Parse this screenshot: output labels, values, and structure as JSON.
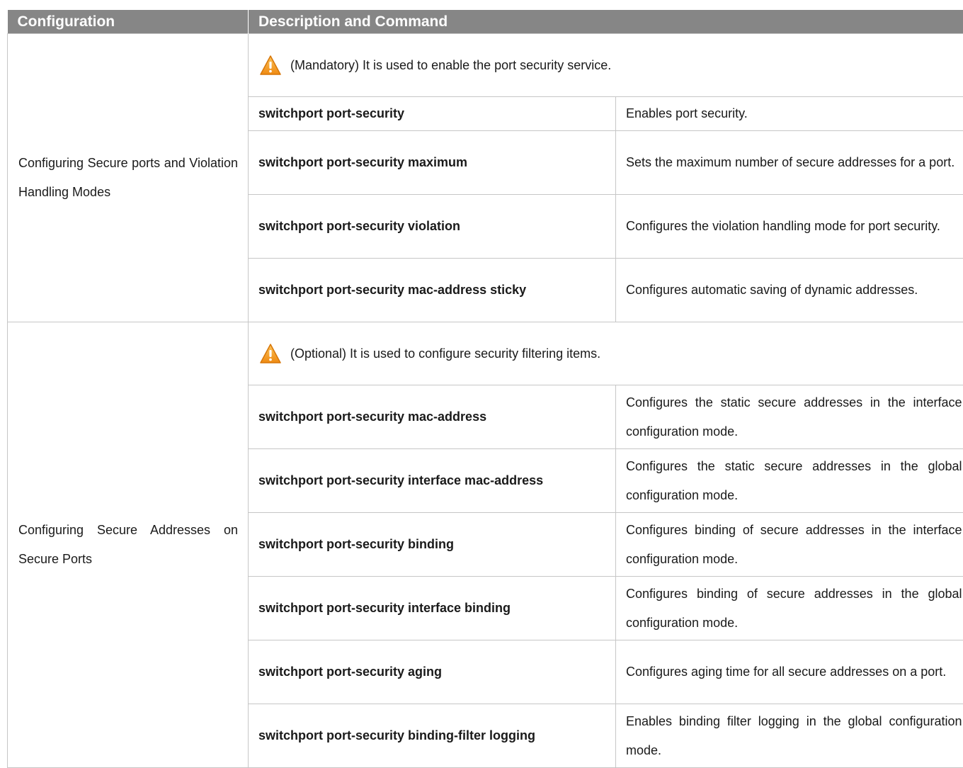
{
  "table": {
    "headers": {
      "configuration": "Configuration",
      "description": "Description and Command"
    },
    "groups": [
      {
        "configuration": "Configuring Secure ports and Violation Handling Modes",
        "note": "(Mandatory) It is used to enable the port security service.",
        "note_icon": "warning-icon",
        "rows": [
          {
            "command": "switchport port-security",
            "description": "Enables port security."
          },
          {
            "command": "switchport port-security maximum",
            "description": "Sets the maximum number of secure addresses for a port."
          },
          {
            "command": "switchport port-security violation",
            "description": "Configures the violation handling mode for port security."
          },
          {
            "command": "switchport port-security mac-address sticky",
            "description": "Configures automatic saving of dynamic addresses."
          }
        ]
      },
      {
        "configuration": "Configuring Secure Addresses on Secure Ports",
        "note": "(Optional) It is used to configure security filtering items.",
        "note_icon": "warning-icon",
        "rows": [
          {
            "command": "switchport port-security mac-address",
            "description": "Configures the static secure addresses in the interface configuration mode."
          },
          {
            "command": "switchport port-security interface mac-address",
            "description": "Configures the static secure addresses in the global configuration mode."
          },
          {
            "command": "switchport port-security binding",
            "description": "Configures binding of secure addresses in the interface configuration mode."
          },
          {
            "command": "switchport port-security interface binding",
            "description": "Configures binding of secure addresses in the global configuration mode."
          },
          {
            "command": "switchport port-security aging",
            "description": "Configures aging time for all secure addresses on a port."
          },
          {
            "command": "switchport port-security binding-filter logging",
            "description": "Enables binding filter logging in the global configuration mode."
          }
        ]
      }
    ]
  },
  "colors": {
    "header_background": "#868686",
    "header_text": "#ffffff",
    "border": "#c6c6c6",
    "warning_fill": "#f5a623"
  }
}
